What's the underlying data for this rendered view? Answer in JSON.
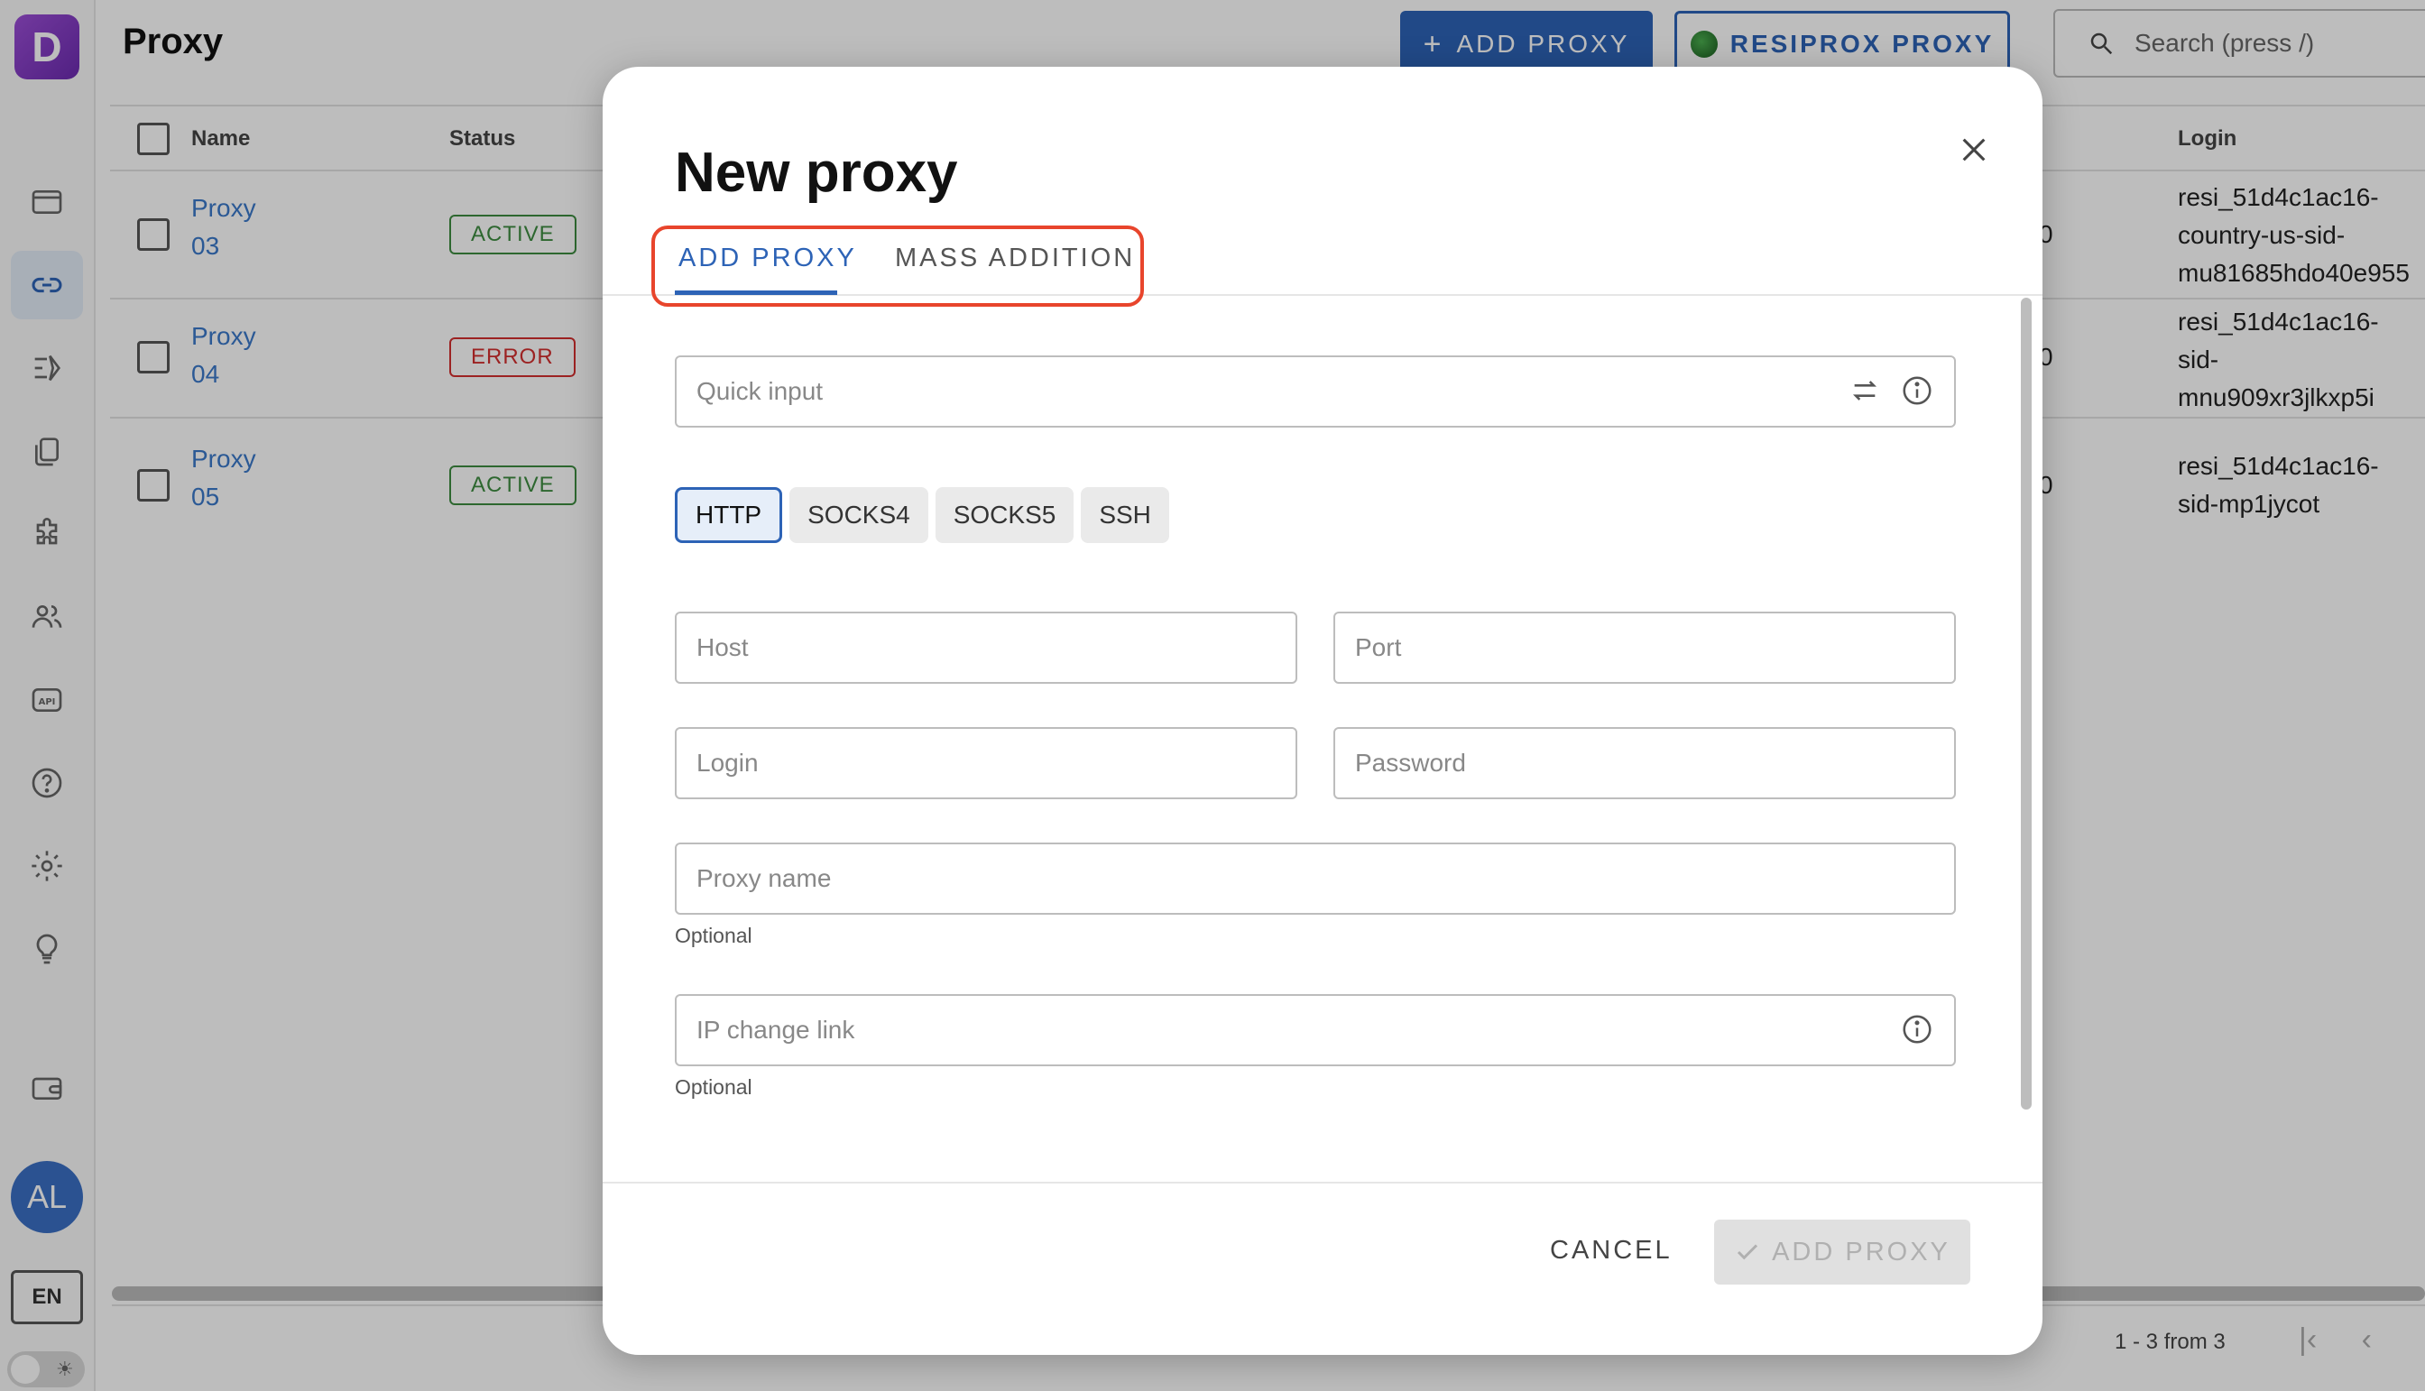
{
  "app": {
    "logo_letter": "D",
    "page_title": "Proxy",
    "user_initials": "AL",
    "language": "EN"
  },
  "sidebar": {
    "items": [
      {
        "icon": "browser-window-icon"
      },
      {
        "icon": "link-icon",
        "active": true
      },
      {
        "icon": "automation-icon"
      },
      {
        "icon": "copy-icon"
      },
      {
        "icon": "extension-icon"
      },
      {
        "icon": "team-icon"
      },
      {
        "icon": "api-icon"
      },
      {
        "icon": "help-icon"
      },
      {
        "icon": "settings-icon"
      },
      {
        "icon": "idea-icon"
      },
      {
        "icon": "wallet-icon"
      }
    ]
  },
  "header": {
    "add_proxy_label": "ADD PROXY",
    "resiprox_label": "RESIPROX PROXY",
    "search_placeholder": "Search (press /)"
  },
  "table": {
    "columns": {
      "name": "Name",
      "status": "Status",
      "login": "Login"
    },
    "rows": [
      {
        "name_line1": "Proxy",
        "name_line2": "03",
        "status": "ACTIVE",
        "port_digit": "0",
        "login_lines": [
          "resi_51d4c1ac16-",
          "country-us-sid-",
          "mu81685hdo40e955"
        ]
      },
      {
        "name_line1": "Proxy",
        "name_line2": "04",
        "status": "ERROR",
        "port_digit": "0",
        "login_lines": [
          "resi_51d4c1ac16-",
          "sid-",
          "mnu909xr3jlkxp5i"
        ]
      },
      {
        "name_line1": "Proxy",
        "name_line2": "05",
        "status": "ACTIVE",
        "port_digit": "0",
        "login_lines": [
          "resi_51d4c1ac16-",
          "sid-mp1jycot"
        ]
      }
    ],
    "pagination": "1 - 3 from 3"
  },
  "modal": {
    "title": "New proxy",
    "tabs": [
      "ADD PROXY",
      "MASS ADDITION"
    ],
    "quick_input_placeholder": "Quick input",
    "types": [
      "HTTP",
      "SOCKS4",
      "SOCKS5",
      "SSH"
    ],
    "selected_type": "HTTP",
    "host_placeholder": "Host",
    "port_placeholder": "Port",
    "login_placeholder": "Login",
    "password_placeholder": "Password",
    "proxy_name_placeholder": "Proxy name",
    "proxy_name_helper": "Optional",
    "ip_change_placeholder": "IP change link",
    "ip_change_helper": "Optional",
    "cancel_label": "CANCEL",
    "confirm_label": "ADD PROXY"
  }
}
